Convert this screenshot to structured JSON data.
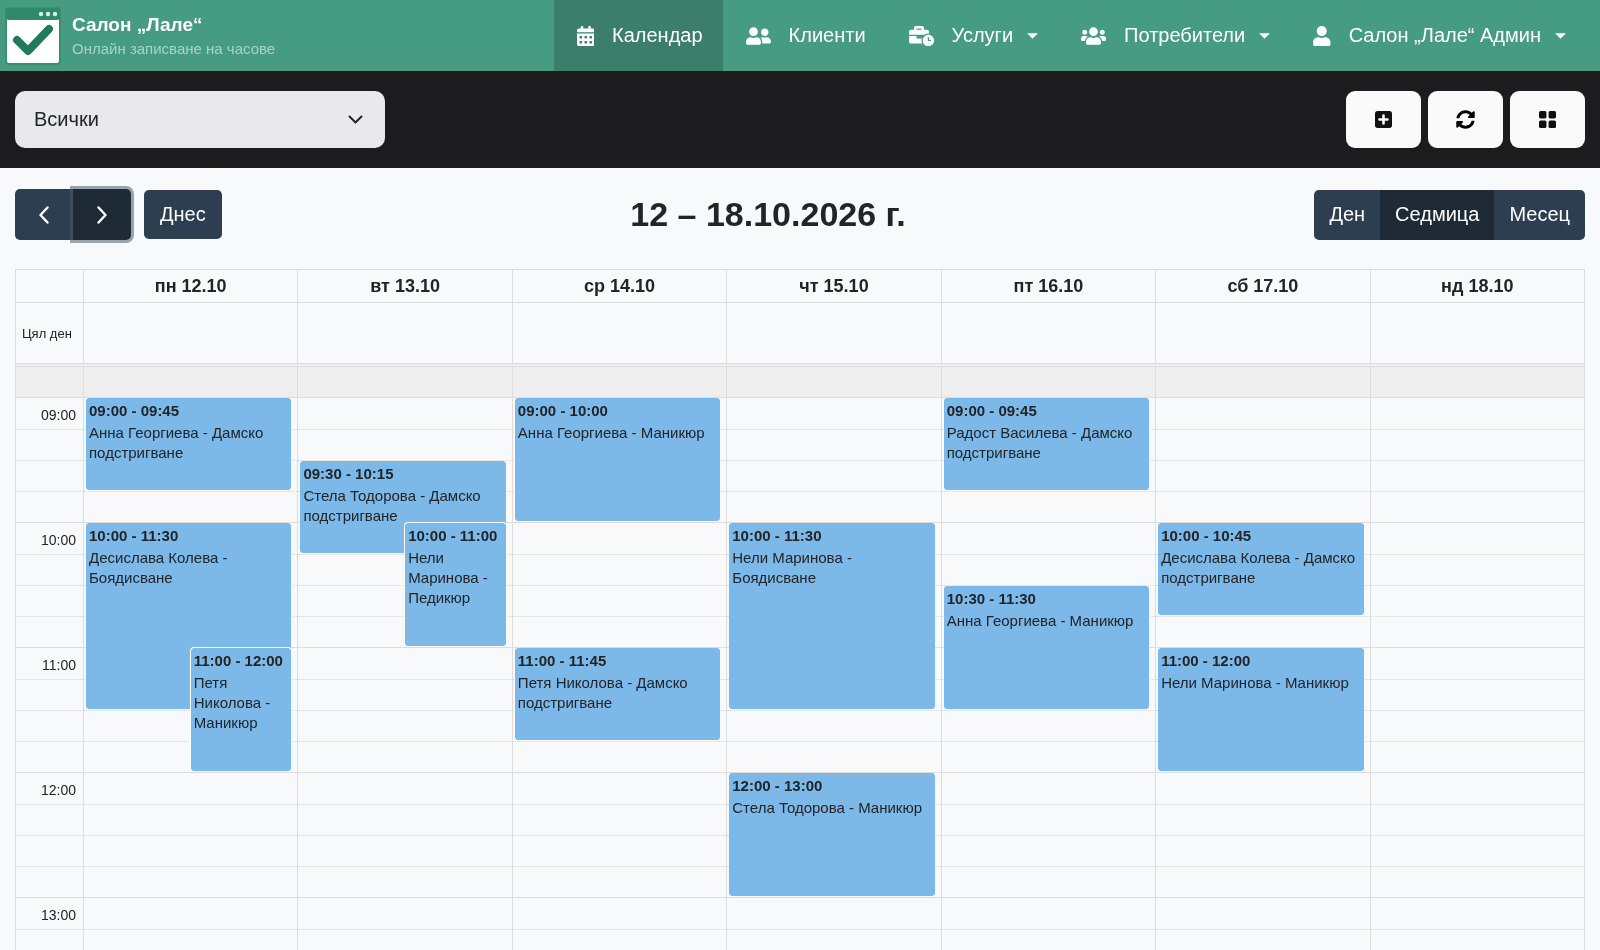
{
  "navbar": {
    "brand": {
      "title": "Салон „Лале“",
      "subtitle": "Онлайн записване на часове"
    },
    "items": [
      {
        "kind": "calendar",
        "label": "Календар",
        "selected": true,
        "dropdown": false
      },
      {
        "kind": "clients",
        "label": "Клиенти",
        "selected": false,
        "dropdown": false
      },
      {
        "kind": "services",
        "label": "Услуги",
        "selected": false,
        "dropdown": true
      },
      {
        "kind": "users",
        "label": "Потребители",
        "selected": false,
        "dropdown": true
      },
      {
        "kind": "account",
        "label": "Салон „Лале“ Админ",
        "selected": false,
        "dropdown": true
      }
    ]
  },
  "toolbar": {
    "filter": {
      "value": "Всички"
    },
    "buttons": [
      {
        "kind": "add"
      },
      {
        "kind": "refresh"
      },
      {
        "kind": "layout"
      }
    ]
  },
  "calendar": {
    "nav_buttons": [
      {
        "kind": "prev",
        "focused": false
      },
      {
        "kind": "next",
        "focused": true
      }
    ],
    "today_button": "Днес",
    "title": "12 – 18.10.2026 г.",
    "views": [
      {
        "label": "Ден",
        "selected": false
      },
      {
        "label": "Седмица",
        "selected": true
      },
      {
        "label": "Месец",
        "selected": false
      }
    ],
    "all_day_label": "Цял ден",
    "time_labels": [
      "09:00",
      "10:00",
      "11:00",
      "12:00",
      "13:00"
    ],
    "days": [
      {
        "label": "пн 12.10",
        "events": [
          {
            "time": "09:00 - 09:45",
            "title": "Анна Георгиева - Дамско подстригване"
          },
          {
            "time": "10:00 - 11:30",
            "title": "Десислава Колева - Боядисване"
          },
          {
            "time": "11:00 - 12:00",
            "title": "Петя Николова - Маникюр"
          }
        ]
      },
      {
        "label": "вт 13.10",
        "events": [
          {
            "time": "09:30 - 10:15",
            "title": "Стела Тодорова - Дамско подстригване"
          },
          {
            "time": "10:00 - 11:00",
            "title": "Нели Маринова - Педикюр"
          }
        ]
      },
      {
        "label": "ср 14.10",
        "events": [
          {
            "time": "09:00 - 10:00",
            "title": "Анна Георгиева - Маникюр"
          },
          {
            "time": "11:00 - 11:45",
            "title": "Петя Николова - Дамско подстригване"
          }
        ]
      },
      {
        "label": "чт 15.10",
        "events": [
          {
            "time": "10:00 - 11:30",
            "title": "Нели Маринова - Боядисване"
          },
          {
            "time": "12:00 - 13:00",
            "title": "Стела Тодорова - Маникюр"
          }
        ]
      },
      {
        "label": "пт 16.10",
        "events": [
          {
            "time": "09:00 - 09:45",
            "title": "Радост Василева - Дамско подстригване"
          },
          {
            "time": "10:30 - 11:30",
            "title": "Анна Георгиева - Маникюр"
          }
        ]
      },
      {
        "label": "сб 17.10",
        "events": [
          {
            "time": "10:00 - 10:45",
            "title": "Десислава Колева - Дамско подстригване"
          },
          {
            "time": "11:00 - 12:00",
            "title": "Нели Маринова - Маникюр"
          }
        ]
      },
      {
        "label": "нд 18.10"
      }
    ]
  }
}
